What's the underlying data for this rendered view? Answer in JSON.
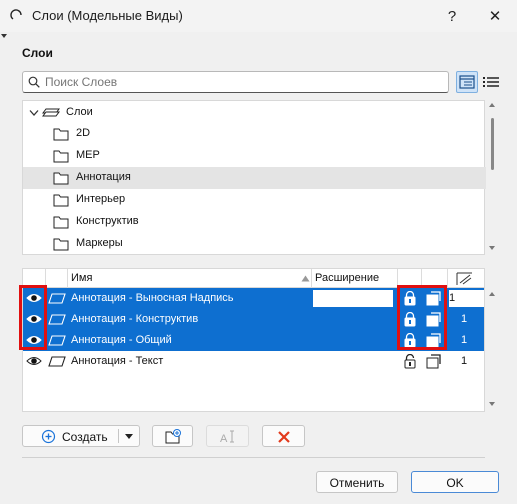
{
  "window": {
    "title": "Слои (Модельные Виды)",
    "help_glyph": "?",
    "close_glyph": "✕"
  },
  "section": {
    "title": "Слои"
  },
  "search": {
    "placeholder": "Поиск Слоев"
  },
  "tree": {
    "root_label": "Слои",
    "items": [
      {
        "label": "2D"
      },
      {
        "label": "MEP"
      },
      {
        "label": "Аннотация",
        "selected": true
      },
      {
        "label": "Интерьер"
      },
      {
        "label": "Конструктив"
      },
      {
        "label": "Маркеры"
      }
    ]
  },
  "table": {
    "columns": {
      "name": "Имя",
      "extension": "Расширение"
    },
    "rows": [
      {
        "name": "Аннотация - Выносная Надпись",
        "value": "1",
        "selected": true
      },
      {
        "name": "Аннотация - Конструктив",
        "value": "1",
        "selected": true
      },
      {
        "name": "Аннотация - Общий",
        "value": "1",
        "selected": true
      },
      {
        "name": "Аннотация - Текст",
        "value": "1",
        "selected": false
      }
    ]
  },
  "buttons": {
    "create": "Создать",
    "cancel": "Отменить",
    "ok": "OK"
  },
  "colors": {
    "selection": "#0e6fd0",
    "highlight": "#e01010",
    "accent": "#1a73d9"
  }
}
